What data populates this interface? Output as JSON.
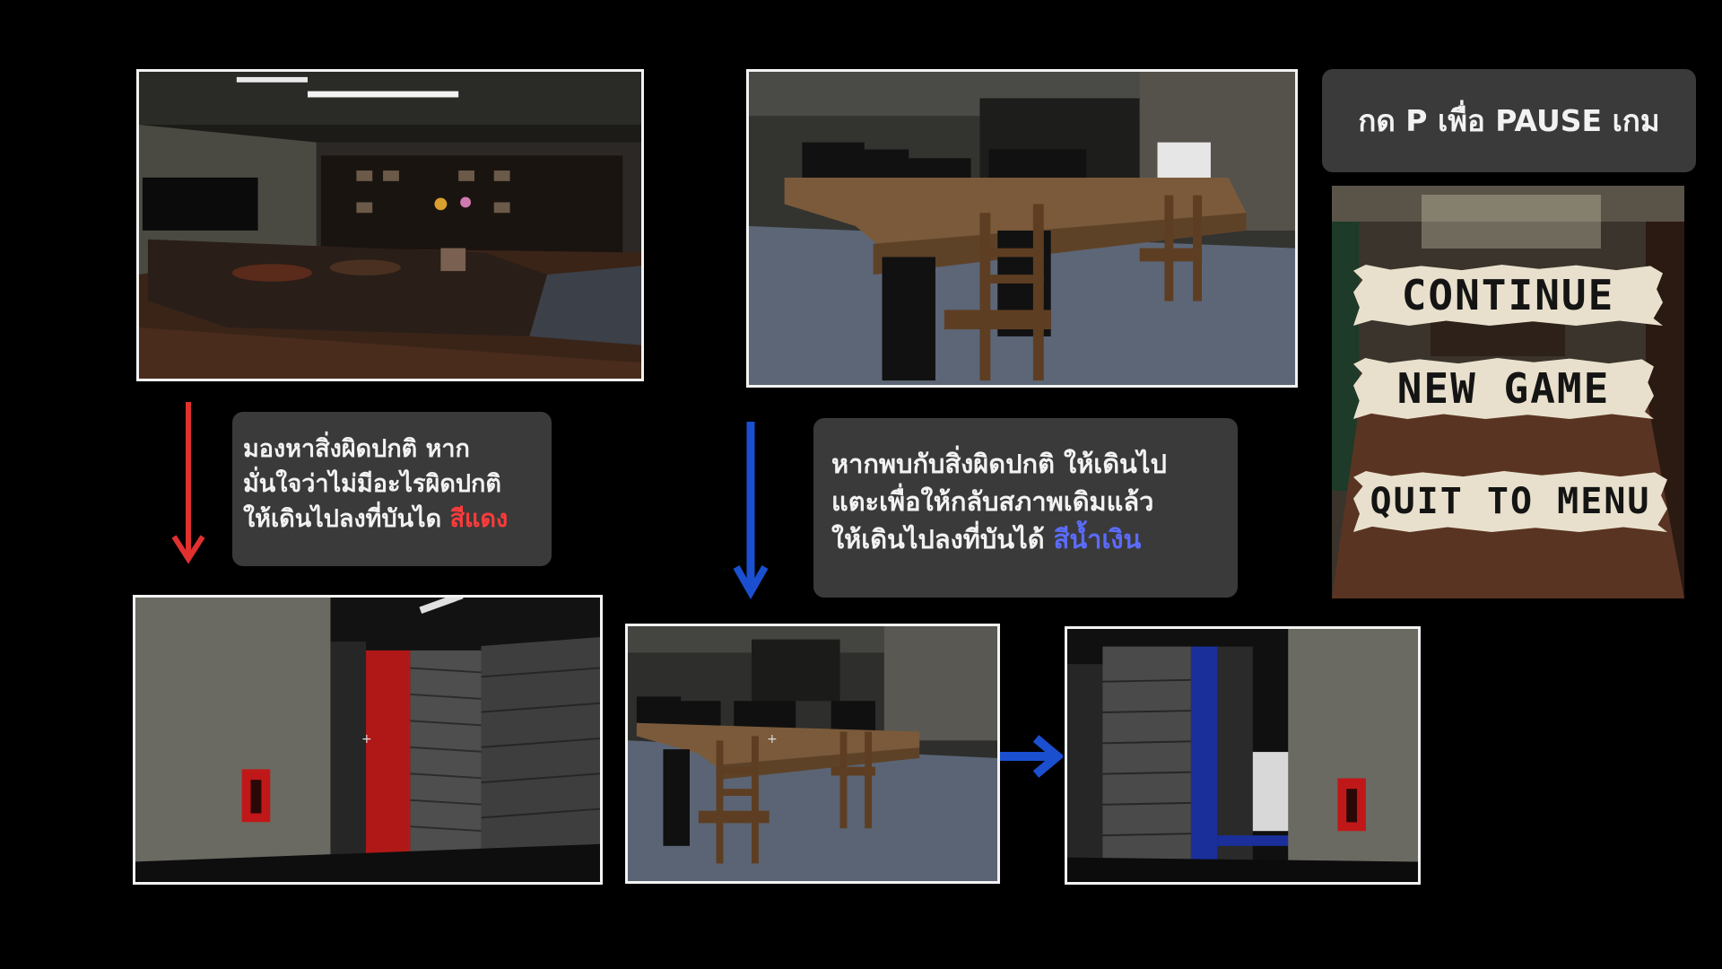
{
  "pause_hint": "กด P เพื่อ PAUSE เกม",
  "red_instruction": {
    "lines": [
      "มองหาสิ่งผิดปกติ หาก",
      "มั่นใจว่าไม่มีอะไรผิดปกติ",
      "ให้เดินไปลงที่บันได "
    ],
    "highlight": "สีแดง",
    "highlight_color": "#ff3b3b"
  },
  "blue_instruction": {
    "lines": [
      "หากพบกับสิ่งผิดปกติ ให้เดินไป",
      "แตะเพื่อให้กลับสภาพเดิมแล้ว",
      "ให้เดินไปลงที่บันได้ "
    ],
    "highlight": "สีน้ำเงิน",
    "highlight_color": "#5b6bff"
  },
  "pause_menu": {
    "items": [
      "CONTINUE",
      "NEW GAME",
      "QUIT TO MENU"
    ]
  },
  "colors": {
    "background": "#000000",
    "bubble": "#3a3a3a",
    "red_arrow": "#e03030",
    "blue_arrow": "#1a4fd0",
    "red_door": "#c01818",
    "blue_door": "#1a2f9a"
  }
}
